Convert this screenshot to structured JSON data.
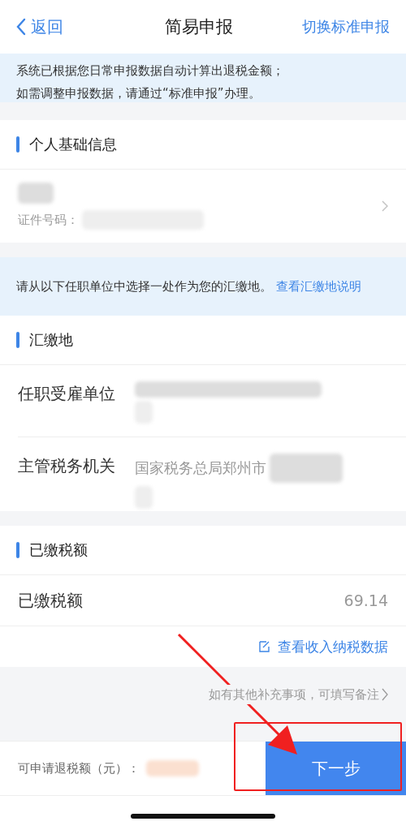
{
  "nav": {
    "back": "返回",
    "title": "简易申报",
    "action": "切换标准申报"
  },
  "notice": {
    "lines": [
      "系统已根据您日常申报数据自动计算出退税金额；",
      "如需调整申报数据，请通过“标准申报”办理。"
    ]
  },
  "personal": {
    "title": "个人基础信息",
    "id_label": "证件号码："
  },
  "notice2": {
    "text": "请从以下任职单位中选择一处作为您的汇缴地。",
    "link": "查看汇缴地说明"
  },
  "settlement": {
    "title": "汇缴地",
    "rows": [
      {
        "label": "任职受雇单位"
      },
      {
        "label": "主管税务机关",
        "value": "国家税务总局郑州市"
      }
    ]
  },
  "paid": {
    "title": "已缴税额",
    "label": "已缴税额",
    "value": "69.14",
    "link": "查看收入纳税数据"
  },
  "remarks": "如有其他补充事项，可填写备注",
  "footer": {
    "label": "可申请退税额（元）：",
    "button": "下一步"
  }
}
